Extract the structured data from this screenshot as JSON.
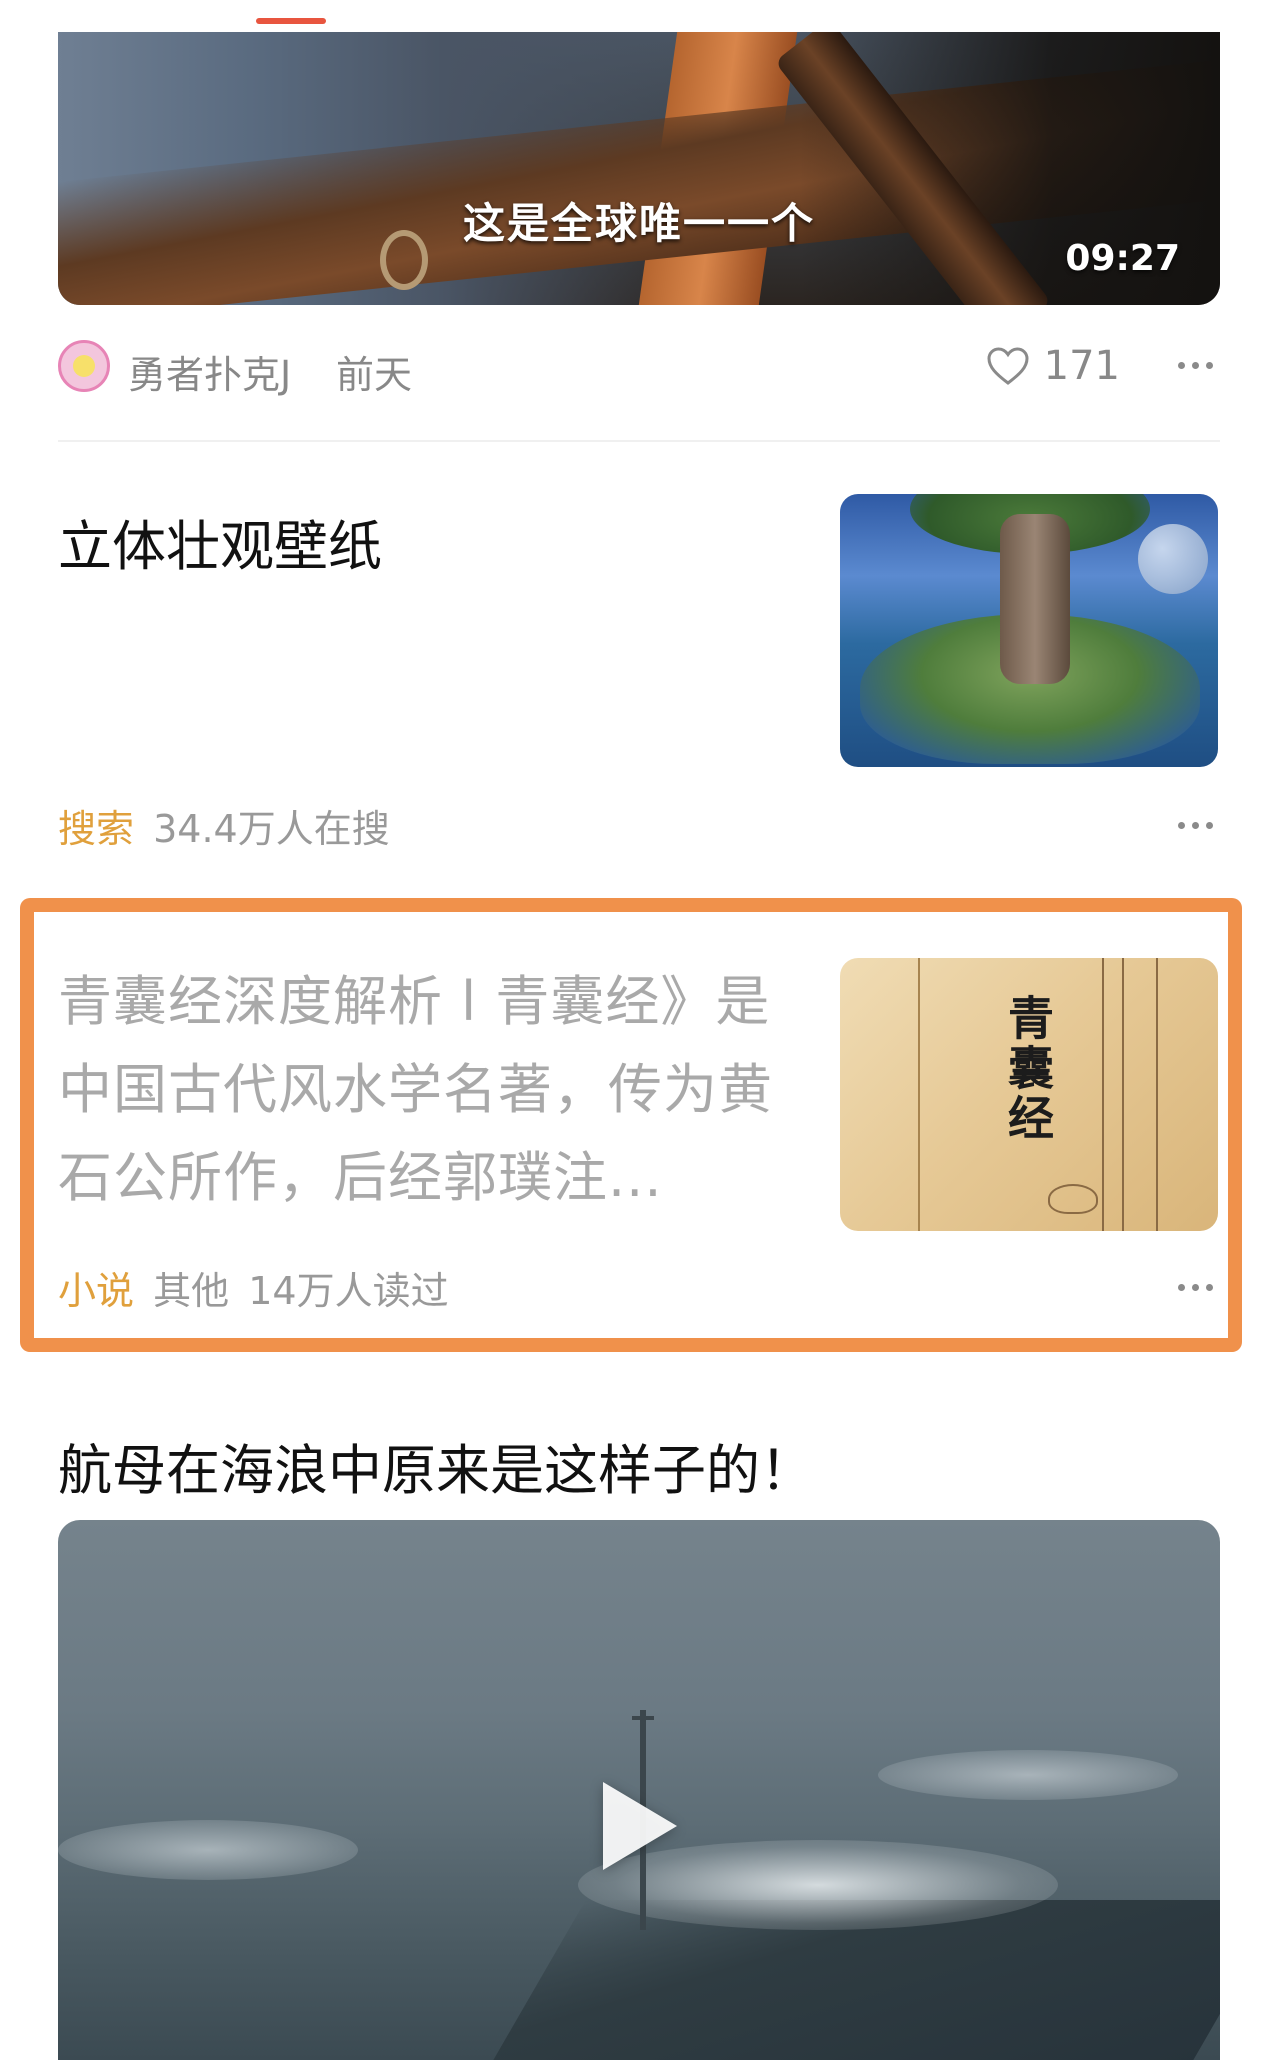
{
  "top_video": {
    "caption": "这是全球唯一一个",
    "duration": "09:27",
    "author": "勇者扑克J",
    "time": "前天",
    "likes": "171"
  },
  "card2": {
    "title": "立体壮观壁纸",
    "tag": "搜索",
    "meta": "34.4万人在搜"
  },
  "card3": {
    "text": "青囊经深度解析 l 青囊经》是中国古代风水学名著，传为黄石公所作，后经郭璞注...",
    "cover_title": "青囊经",
    "tag": "小说",
    "category": "其他",
    "reads": "14万人读过"
  },
  "card4": {
    "title": "航母在海浪中原来是这样子的！"
  },
  "colors": {
    "accent_orange": "#f0914b",
    "tag_orange": "#e0a03c",
    "tab_indicator": "#e8553f"
  }
}
